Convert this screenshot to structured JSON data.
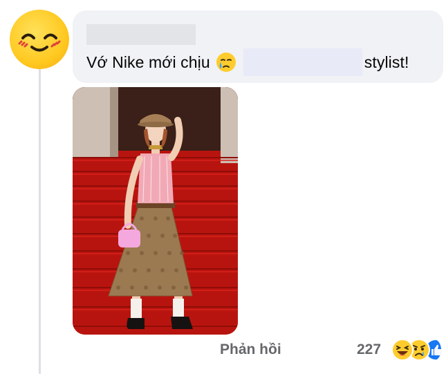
{
  "comment": {
    "author_name": "",
    "text_before": "Vớ Nike mới chịu",
    "text_after": "stylist!"
  },
  "footer": {
    "reply_label": "Phản hồi",
    "reaction_count": "227",
    "reactions": [
      "haha",
      "sad",
      "like"
    ]
  },
  "colors": {
    "bubble_bg": "#f0f2f5",
    "secondary_text": "#65676b",
    "redaction_name": "#e2e4e8",
    "redaction_text": "#e9eaf7",
    "like_blue": "#1877f2"
  }
}
